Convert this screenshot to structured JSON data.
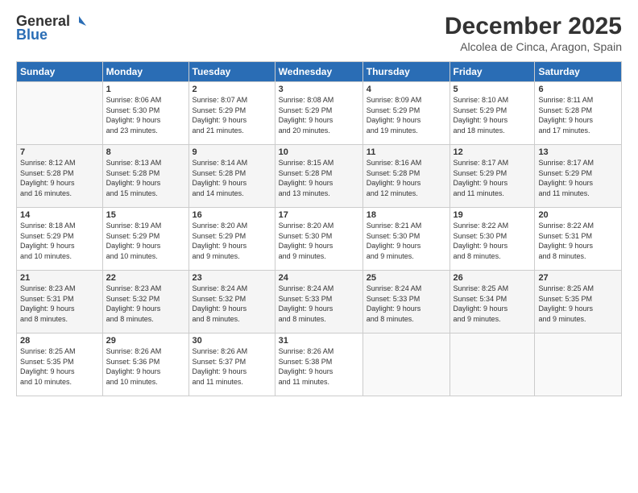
{
  "logo": {
    "general": "General",
    "blue": "Blue"
  },
  "title": "December 2025",
  "subtitle": "Alcolea de Cinca, Aragon, Spain",
  "days_of_week": [
    "Sunday",
    "Monday",
    "Tuesday",
    "Wednesday",
    "Thursday",
    "Friday",
    "Saturday"
  ],
  "weeks": [
    [
      {
        "day": "",
        "info": ""
      },
      {
        "day": "1",
        "info": "Sunrise: 8:06 AM\nSunset: 5:30 PM\nDaylight: 9 hours\nand 23 minutes."
      },
      {
        "day": "2",
        "info": "Sunrise: 8:07 AM\nSunset: 5:29 PM\nDaylight: 9 hours\nand 21 minutes."
      },
      {
        "day": "3",
        "info": "Sunrise: 8:08 AM\nSunset: 5:29 PM\nDaylight: 9 hours\nand 20 minutes."
      },
      {
        "day": "4",
        "info": "Sunrise: 8:09 AM\nSunset: 5:29 PM\nDaylight: 9 hours\nand 19 minutes."
      },
      {
        "day": "5",
        "info": "Sunrise: 8:10 AM\nSunset: 5:29 PM\nDaylight: 9 hours\nand 18 minutes."
      },
      {
        "day": "6",
        "info": "Sunrise: 8:11 AM\nSunset: 5:28 PM\nDaylight: 9 hours\nand 17 minutes."
      }
    ],
    [
      {
        "day": "7",
        "info": "Sunrise: 8:12 AM\nSunset: 5:28 PM\nDaylight: 9 hours\nand 16 minutes."
      },
      {
        "day": "8",
        "info": "Sunrise: 8:13 AM\nSunset: 5:28 PM\nDaylight: 9 hours\nand 15 minutes."
      },
      {
        "day": "9",
        "info": "Sunrise: 8:14 AM\nSunset: 5:28 PM\nDaylight: 9 hours\nand 14 minutes."
      },
      {
        "day": "10",
        "info": "Sunrise: 8:15 AM\nSunset: 5:28 PM\nDaylight: 9 hours\nand 13 minutes."
      },
      {
        "day": "11",
        "info": "Sunrise: 8:16 AM\nSunset: 5:28 PM\nDaylight: 9 hours\nand 12 minutes."
      },
      {
        "day": "12",
        "info": "Sunrise: 8:17 AM\nSunset: 5:29 PM\nDaylight: 9 hours\nand 11 minutes."
      },
      {
        "day": "13",
        "info": "Sunrise: 8:17 AM\nSunset: 5:29 PM\nDaylight: 9 hours\nand 11 minutes."
      }
    ],
    [
      {
        "day": "14",
        "info": "Sunrise: 8:18 AM\nSunset: 5:29 PM\nDaylight: 9 hours\nand 10 minutes."
      },
      {
        "day": "15",
        "info": "Sunrise: 8:19 AM\nSunset: 5:29 PM\nDaylight: 9 hours\nand 10 minutes."
      },
      {
        "day": "16",
        "info": "Sunrise: 8:20 AM\nSunset: 5:29 PM\nDaylight: 9 hours\nand 9 minutes."
      },
      {
        "day": "17",
        "info": "Sunrise: 8:20 AM\nSunset: 5:30 PM\nDaylight: 9 hours\nand 9 minutes."
      },
      {
        "day": "18",
        "info": "Sunrise: 8:21 AM\nSunset: 5:30 PM\nDaylight: 9 hours\nand 9 minutes."
      },
      {
        "day": "19",
        "info": "Sunrise: 8:22 AM\nSunset: 5:30 PM\nDaylight: 9 hours\nand 8 minutes."
      },
      {
        "day": "20",
        "info": "Sunrise: 8:22 AM\nSunset: 5:31 PM\nDaylight: 9 hours\nand 8 minutes."
      }
    ],
    [
      {
        "day": "21",
        "info": "Sunrise: 8:23 AM\nSunset: 5:31 PM\nDaylight: 9 hours\nand 8 minutes."
      },
      {
        "day": "22",
        "info": "Sunrise: 8:23 AM\nSunset: 5:32 PM\nDaylight: 9 hours\nand 8 minutes."
      },
      {
        "day": "23",
        "info": "Sunrise: 8:24 AM\nSunset: 5:32 PM\nDaylight: 9 hours\nand 8 minutes."
      },
      {
        "day": "24",
        "info": "Sunrise: 8:24 AM\nSunset: 5:33 PM\nDaylight: 9 hours\nand 8 minutes."
      },
      {
        "day": "25",
        "info": "Sunrise: 8:24 AM\nSunset: 5:33 PM\nDaylight: 9 hours\nand 8 minutes."
      },
      {
        "day": "26",
        "info": "Sunrise: 8:25 AM\nSunset: 5:34 PM\nDaylight: 9 hours\nand 9 minutes."
      },
      {
        "day": "27",
        "info": "Sunrise: 8:25 AM\nSunset: 5:35 PM\nDaylight: 9 hours\nand 9 minutes."
      }
    ],
    [
      {
        "day": "28",
        "info": "Sunrise: 8:25 AM\nSunset: 5:35 PM\nDaylight: 9 hours\nand 10 minutes."
      },
      {
        "day": "29",
        "info": "Sunrise: 8:26 AM\nSunset: 5:36 PM\nDaylight: 9 hours\nand 10 minutes."
      },
      {
        "day": "30",
        "info": "Sunrise: 8:26 AM\nSunset: 5:37 PM\nDaylight: 9 hours\nand 11 minutes."
      },
      {
        "day": "31",
        "info": "Sunrise: 8:26 AM\nSunset: 5:38 PM\nDaylight: 9 hours\nand 11 minutes."
      },
      {
        "day": "",
        "info": ""
      },
      {
        "day": "",
        "info": ""
      },
      {
        "day": "",
        "info": ""
      }
    ]
  ]
}
